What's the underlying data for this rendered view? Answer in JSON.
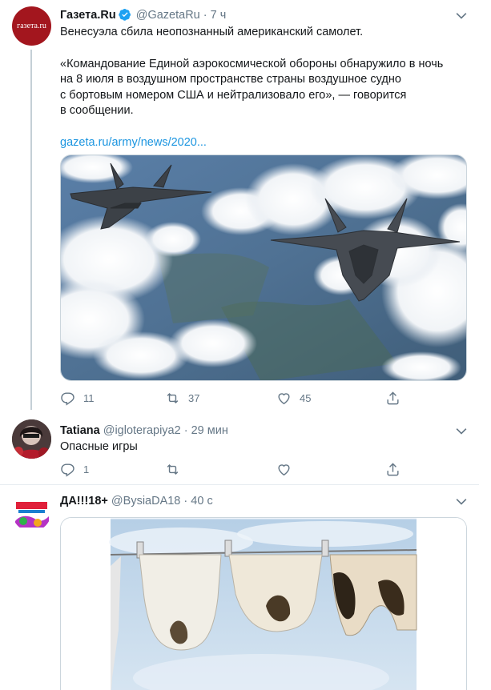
{
  "tweets": [
    {
      "author_name": "Газета.Ru",
      "handle": "@GazetaRu",
      "separator": "·",
      "time": "7 ч",
      "avatar_text": "газета.ru",
      "text_line1": "Венесуэла сбила неопознанный американский самолет.",
      "quote_lines": [
        "«Командование Единой аэрокосмической обороны обнаружило в ночь",
        "на 8 июля в воздушном пространстве страны воздушное судно",
        "с бортовым номером США и нейтрализовало его», — говорится",
        "в сообщении."
      ],
      "link": "gazeta.ru/army/news/2020...",
      "replies": "11",
      "retweets": "37",
      "likes": "45"
    },
    {
      "author_name": "Tatiana",
      "handle": "@igloterapiya2",
      "separator": "·",
      "time": "29 мин",
      "text": "Опасные игры",
      "replies": "1",
      "retweets": "",
      "likes": ""
    },
    {
      "author_name": "ДА!!!18+",
      "handle": "@BysiaDA18",
      "separator": "·",
      "time": "40 с"
    }
  ],
  "colors": {
    "accent": "#1b95e0",
    "muted": "#657786",
    "gazeta_red": "#a3161e"
  }
}
